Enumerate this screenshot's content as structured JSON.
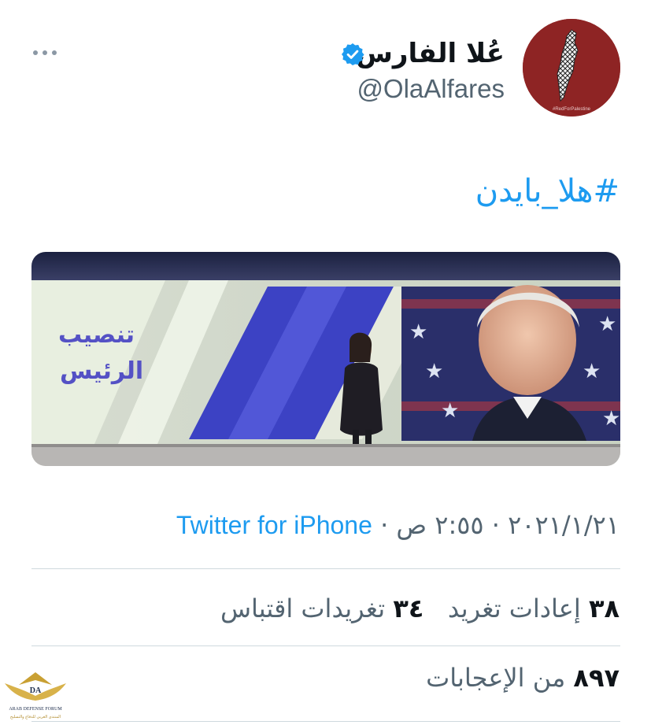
{
  "tweet": {
    "display_name": "عُلا الفارس",
    "handle": "@OlaAlfares",
    "verified": true,
    "hashtag": "#هلا_بايدن",
    "more_icon": "more-horizontal-icon",
    "avatar": {
      "caption": "#RedForPalestine",
      "background": "#8e2424"
    },
    "media": {
      "title_line1": "تنصيب",
      "title_line2": "الرئيس"
    },
    "date": "٢٠٢١/١/٢١",
    "time": "٢:٥٥ ص",
    "separator": "·",
    "source": "Twitter for iPhone",
    "retweets_count": "٣٨",
    "retweets_label": "إعادات تغريد",
    "quotes_count": "٣٤",
    "quotes_label": "تغريدات اقتباس",
    "likes_count": "٨٩٧",
    "likes_label": "من الإعجابات"
  },
  "watermark": {
    "initials": "DA",
    "line1": "ARAB DEFENSE FORUM",
    "line2": "المنتدى العربي للدفاع والتسليح"
  },
  "colors": {
    "accent": "#1d9bf0",
    "text_primary": "#0f1419",
    "text_secondary": "#536471",
    "divider": "#cfd9de"
  }
}
